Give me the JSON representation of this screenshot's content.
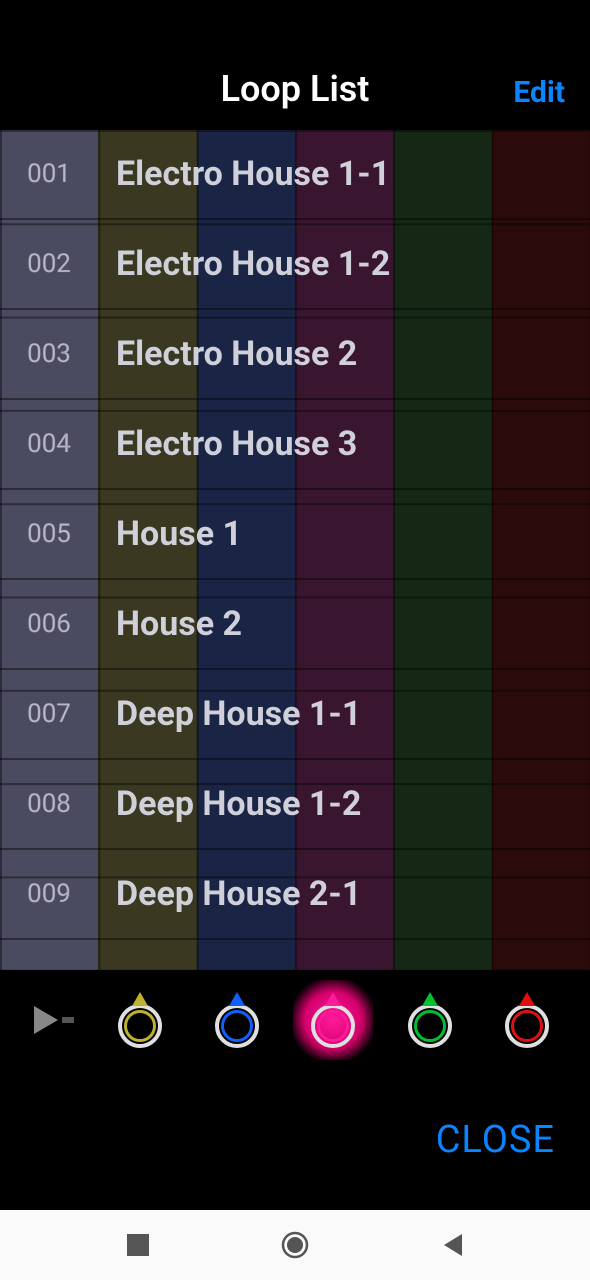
{
  "header": {
    "title": "Loop List",
    "edit_label": "Edit"
  },
  "loops": [
    {
      "index": "001",
      "name": "Electro House 1-1"
    },
    {
      "index": "002",
      "name": "Electro House 1-2"
    },
    {
      "index": "003",
      "name": "Electro House 2"
    },
    {
      "index": "004",
      "name": "Electro House 3"
    },
    {
      "index": "005",
      "name": "House 1"
    },
    {
      "index": "006",
      "name": "House 2"
    },
    {
      "index": "007",
      "name": "Deep House 1-1"
    },
    {
      "index": "008",
      "name": "Deep House 1-2"
    },
    {
      "index": "009",
      "name": "Deep House 2-1"
    }
  ],
  "color_buttons": [
    {
      "name": "yellow",
      "color": "#c0b030",
      "active": false
    },
    {
      "name": "blue",
      "color": "#1060ff",
      "active": false
    },
    {
      "name": "pink",
      "color": "#ff1a9c",
      "active": true
    },
    {
      "name": "green",
      "color": "#00c030",
      "active": false
    },
    {
      "name": "red",
      "color": "#e01010",
      "active": false
    }
  ],
  "footer": {
    "close_label": "CLOSE"
  }
}
